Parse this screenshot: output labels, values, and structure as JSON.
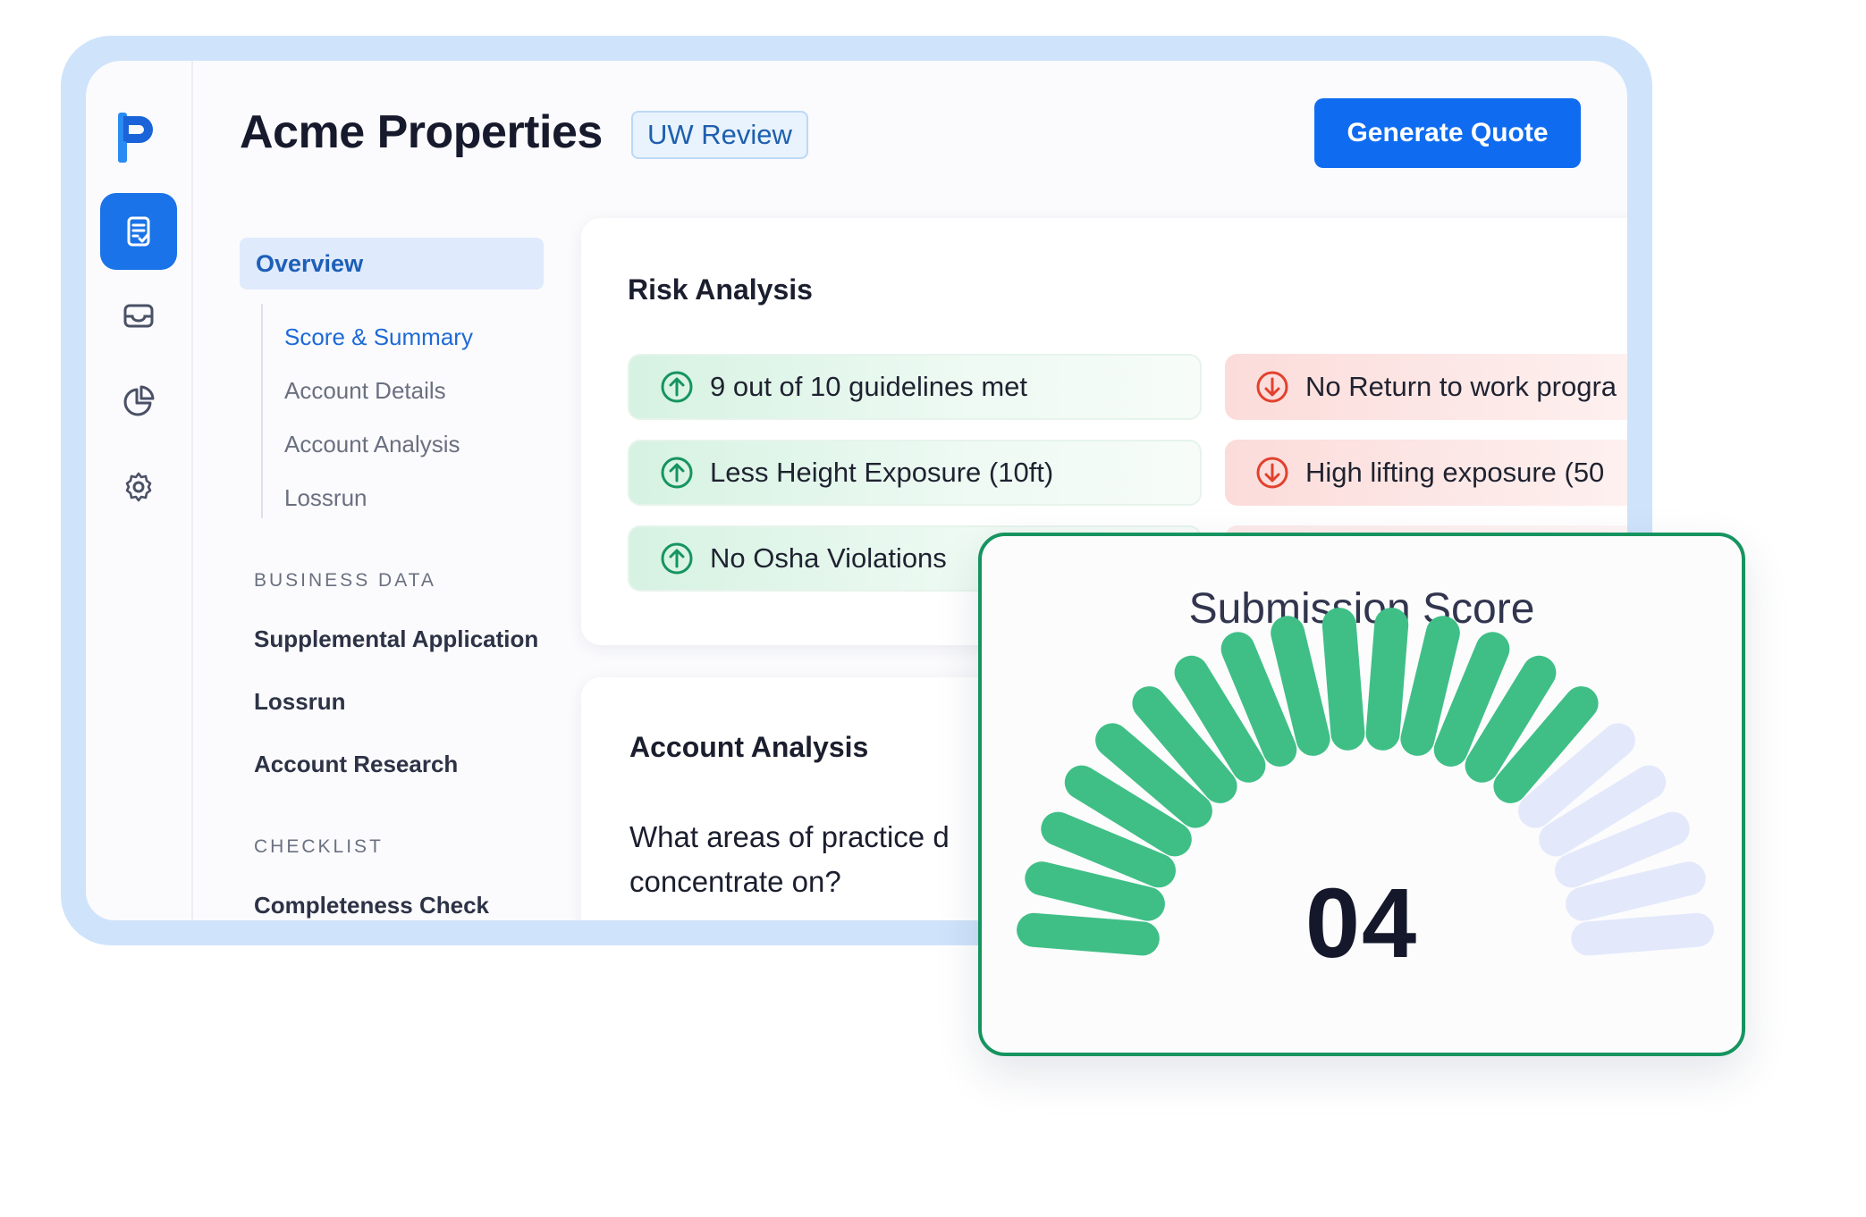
{
  "header": {
    "title": "Acme Properties",
    "status_badge": "UW Review",
    "primary_action": "Generate Quote"
  },
  "rail": {
    "items": [
      {
        "icon": "document-check-icon",
        "active": true
      },
      {
        "icon": "inbox-icon",
        "active": false
      },
      {
        "icon": "pie-chart-icon",
        "active": false
      },
      {
        "icon": "gear-icon",
        "active": false
      }
    ]
  },
  "subnav": {
    "overview": "Overview",
    "links": [
      "Score & Summary",
      "Account Details",
      "Account Analysis",
      "Lossrun"
    ],
    "business_data_label": "BUSINESS DATA",
    "business_data": [
      "Supplemental Application",
      "Lossrun",
      "Account Research"
    ],
    "checklist_label": "CHECKLIST",
    "checklist": [
      "Completeness Check"
    ]
  },
  "risk_analysis": {
    "title": "Risk Analysis",
    "positives": [
      "9 out of 10 guidelines met",
      "Less Height Exposure (10ft)",
      "No Osha Violations"
    ],
    "negatives": [
      "No Return to work progra",
      "High lifting exposure (50"
    ]
  },
  "account_analysis": {
    "title": "Account Analysis",
    "question_line1": "What areas of practice d",
    "question_line2": "concentrate on?"
  },
  "submission_score": {
    "title": "Submission Score",
    "value": "04",
    "filled_segments": 15,
    "total_segments": 20,
    "filled_color": "#3fbf86",
    "empty_color": "#e3e8fb"
  },
  "colors": {
    "primary": "#0f6cf0",
    "positive": "#16945f",
    "negative": "#e2412e",
    "frame": "#cfe3fb"
  }
}
